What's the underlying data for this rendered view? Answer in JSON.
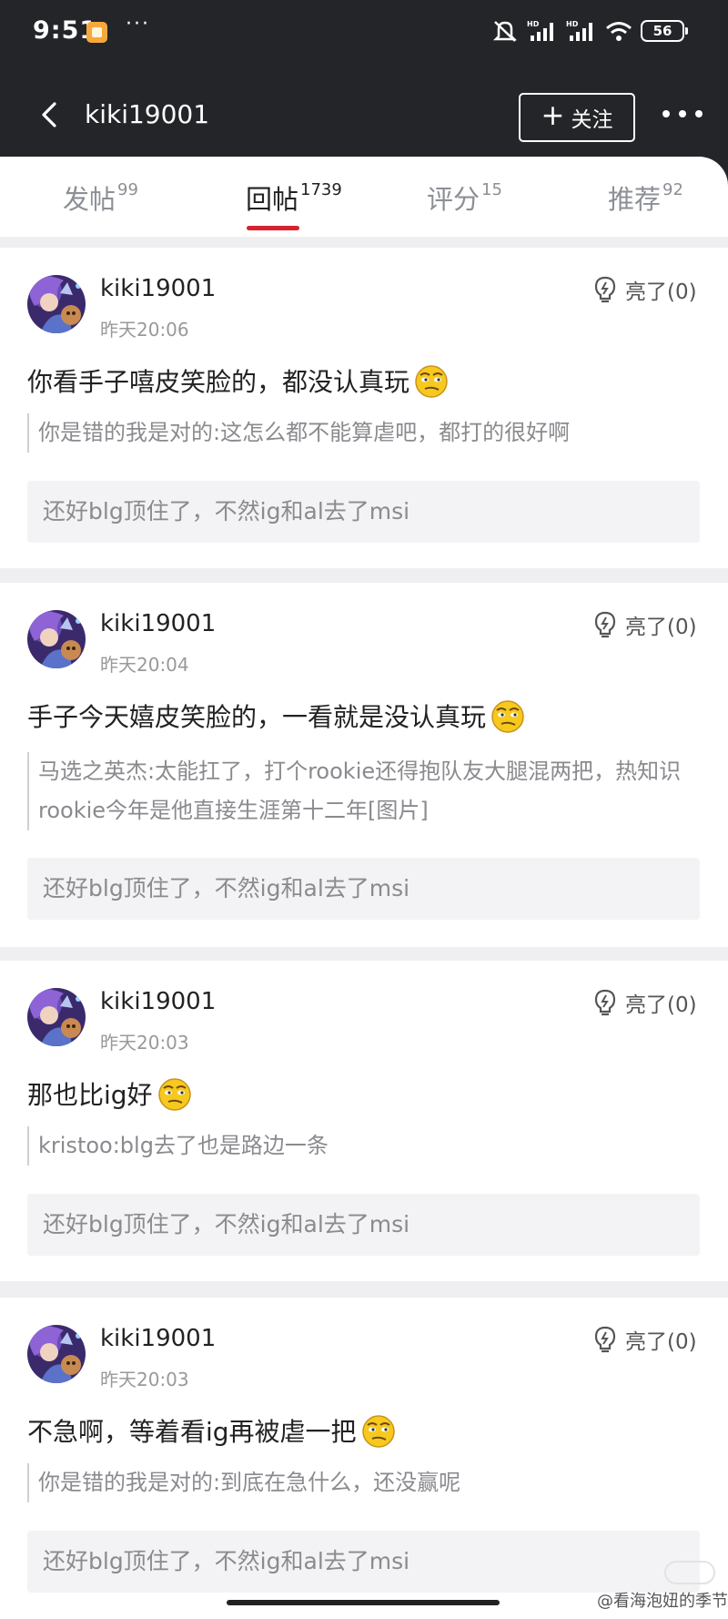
{
  "status_bar": {
    "time": "9:51",
    "more": "···",
    "battery": "56"
  },
  "nav": {
    "title": "kiki19001",
    "follow_label": "关注"
  },
  "tabs": [
    {
      "label": "发帖",
      "count": "99"
    },
    {
      "label": "回帖",
      "count": "1739",
      "active": true
    },
    {
      "label": "评分",
      "count": "15"
    },
    {
      "label": "推荐",
      "count": "92"
    }
  ],
  "posts": [
    {
      "username": "kiki19001",
      "time": "昨天20:06",
      "like_label": "亮了(0)",
      "text": "你看手子嘻皮笑脸的，都没认真玩",
      "quote": "你是错的我是对的:这怎么都不能算虐吧，都打的很好啊",
      "origin": "还好blg顶住了，不然ig和al去了msi"
    },
    {
      "username": "kiki19001",
      "time": "昨天20:04",
      "like_label": "亮了(0)",
      "text": "手子今天嬉皮笑脸的，一看就是没认真玩",
      "quote": "马选之英杰:太能扛了，打个rookie还得抱队友大腿混两把，热知识rookie今年是他直接生涯第十二年[图片]",
      "origin": "还好blg顶住了，不然ig和al去了msi"
    },
    {
      "username": "kiki19001",
      "time": "昨天20:03",
      "like_label": "亮了(0)",
      "text": "那也比ig好",
      "quote": "kristoo:blg去了也是路边一条",
      "origin": "还好blg顶住了，不然ig和al去了msi"
    },
    {
      "username": "kiki19001",
      "time": "昨天20:03",
      "like_label": "亮了(0)",
      "text": "不急啊，等着看ig再被虐一把",
      "quote": "你是错的我是对的:到底在急什么，还没赢呢",
      "origin": "还好blg顶住了，不然ig和al去了msi"
    }
  ],
  "watermark": "@看海泡妞的季节",
  "colors": {
    "header_bg": "#242529",
    "accent": "#d6232f",
    "emoji_yellow": "#f7c81e"
  }
}
